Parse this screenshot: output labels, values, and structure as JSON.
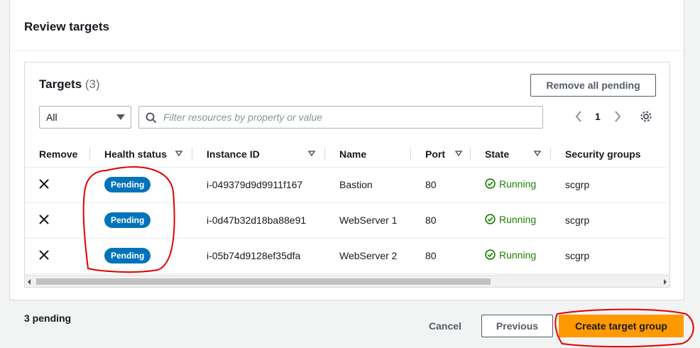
{
  "panel": {
    "title": "Review targets"
  },
  "targets": {
    "title": "Targets",
    "count": "(3)",
    "remove_all_label": "Remove all pending",
    "filter_select": "All",
    "filter_placeholder": "Filter resources by property or value",
    "page": "1"
  },
  "columns": [
    {
      "label": "Remove",
      "sortable": false
    },
    {
      "label": "Health status",
      "sortable": true
    },
    {
      "label": "Instance ID",
      "sortable": true
    },
    {
      "label": "Name",
      "sortable": false
    },
    {
      "label": "Port",
      "sortable": true
    },
    {
      "label": "State",
      "sortable": true
    },
    {
      "label": "Security groups",
      "sortable": true
    }
  ],
  "rows": [
    {
      "health": "Pending",
      "instance_id": "i-049379d9d9911f167",
      "name": "Bastion",
      "port": "80",
      "state": "Running",
      "security_group": "scgrp"
    },
    {
      "health": "Pending",
      "instance_id": "i-0d47b32d18ba88e91",
      "name": "WebServer 1",
      "port": "80",
      "state": "Running",
      "security_group": "scgrp"
    },
    {
      "health": "Pending",
      "instance_id": "i-05b74d9128ef35dfa",
      "name": "WebServer 2",
      "port": "80",
      "state": "Running",
      "security_group": "scgrp"
    }
  ],
  "footer": {
    "pending": "3 pending",
    "cancel_label": "Cancel",
    "previous_label": "Previous",
    "create_label": "Create target group"
  },
  "colors": {
    "primary": "#ff9900",
    "badge": "#0073bb",
    "running": "#1d8102",
    "annotation": "#e00000"
  },
  "icons": [
    "close-icon",
    "search-icon",
    "chevron-left-icon",
    "chevron-right-icon",
    "gear-icon",
    "sort-caret-icon",
    "status-ok-icon"
  ]
}
